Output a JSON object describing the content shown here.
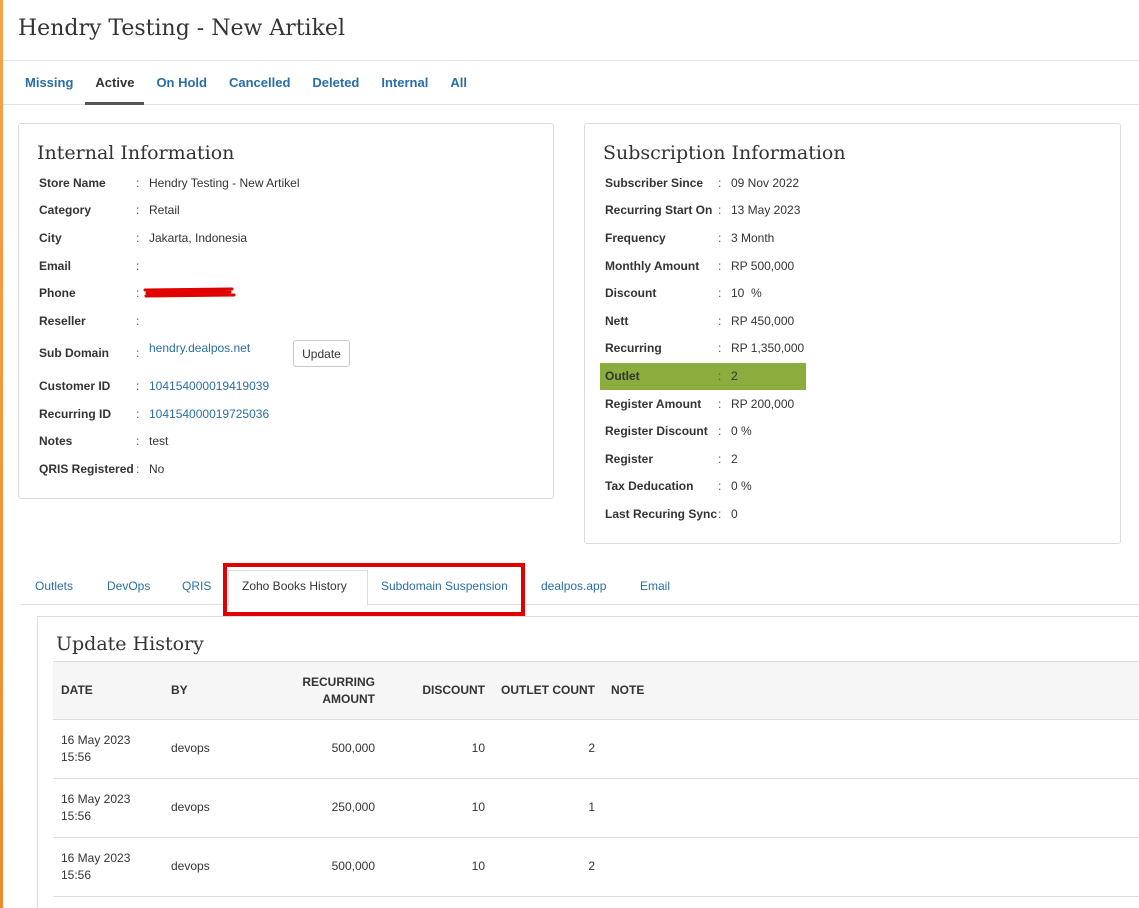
{
  "page": {
    "title": "Hendry Testing - New Artikel"
  },
  "status_tabs": [
    "Missing",
    "Active",
    "On Hold",
    "Cancelled",
    "Deleted",
    "Internal",
    "All"
  ],
  "internal": {
    "title": "Internal Information",
    "rows": [
      {
        "label": "Store Name",
        "value": "Hendry Testing - New Artikel"
      },
      {
        "label": "Category",
        "value": "Retail"
      },
      {
        "label": "City",
        "value": "Jakarta, Indonesia"
      },
      {
        "label": "Email",
        "value": ""
      },
      {
        "label": "Phone",
        "value": ""
      },
      {
        "label": "Reseller",
        "value": ""
      },
      {
        "label": "Sub Domain",
        "value": "hendry.dealpos.net"
      },
      {
        "label": "Customer ID",
        "value": "104154000019419039"
      },
      {
        "label": "Recurring ID",
        "value": "104154000019725036"
      },
      {
        "label": "Notes",
        "value": "test"
      },
      {
        "label": "QRIS Registered",
        "value": "No"
      }
    ],
    "update_button": "Update"
  },
  "subscription": {
    "title": "Subscription Information",
    "rows": [
      {
        "label": "Subscriber Since",
        "value": "09 Nov 2022"
      },
      {
        "label": "Recurring Start On",
        "value": "13 May 2023"
      },
      {
        "label": "Frequency",
        "value": "3 Month"
      },
      {
        "label": "Monthly Amount",
        "value": "RP 500,000"
      },
      {
        "label": "Discount",
        "value": "10  %"
      },
      {
        "label": "Nett",
        "value": "RP 450,000"
      },
      {
        "label": "Recurring",
        "value": "RP 1,350,000"
      },
      {
        "label": "Outlet",
        "value": "2"
      },
      {
        "label": "Register Amount",
        "value": "RP 200,000"
      },
      {
        "label": "Register Discount",
        "value": "0 %"
      },
      {
        "label": "Register",
        "value": "2"
      },
      {
        "label": "Tax Deducation",
        "value": "0 %"
      },
      {
        "label": "Last Recuring Sync",
        "value": "0"
      }
    ],
    "highlight_color": "#8bad3d"
  },
  "sub_tabs": [
    "Outlets",
    "DevOps",
    "QRIS",
    "Zoho Books History",
    "Subdomain Suspension",
    "dealpos.app",
    "Email"
  ],
  "history": {
    "title": "Update History",
    "columns": {
      "date": "DATE",
      "by": "BY",
      "recurring_1": "RECURRING",
      "recurring_2": "AMOUNT",
      "discount": "DISCOUNT",
      "outlet": "OUTLET COUNT",
      "note": "NOTE"
    },
    "rows": [
      {
        "date": "16 May 2023",
        "time": "15:56",
        "by": "devops",
        "amount": "500,000",
        "discount": "10",
        "outlet": "2",
        "note": ""
      },
      {
        "date": "16 May 2023",
        "time": "15:56",
        "by": "devops",
        "amount": "250,000",
        "discount": "10",
        "outlet": "1",
        "note": ""
      },
      {
        "date": "16 May 2023",
        "time": "15:56",
        "by": "devops",
        "amount": "500,000",
        "discount": "10",
        "outlet": "2",
        "note": ""
      }
    ]
  },
  "colors": {
    "link": "#2a6ea6",
    "accent": "#f08a2a",
    "annotation": "#e00000"
  }
}
